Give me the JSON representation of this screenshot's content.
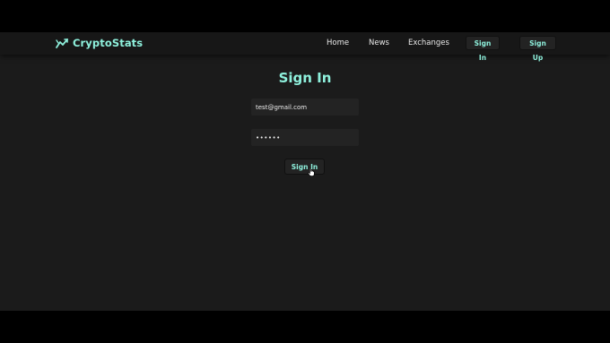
{
  "navbar": {
    "brand": {
      "name": "CryptoStats",
      "icon": "chart-trend-icon"
    },
    "links": {
      "home": "Home",
      "news": "News",
      "exchanges": "Exchanges"
    },
    "buttons": {
      "sign_in": "Sign In",
      "sign_up": "Sign Up"
    }
  },
  "form": {
    "title": "Sign In",
    "email_value": "test@gmail.com",
    "password_display": "••••••",
    "submit_label": "Sign In"
  },
  "colors": {
    "accent": "#8ef0dc",
    "page_background": "#1b1b1b",
    "navbar_background": "#171717",
    "field_background": "#232323",
    "letterbox": "#000000"
  },
  "cursor": {
    "icon": "hand-pointer-icon"
  }
}
